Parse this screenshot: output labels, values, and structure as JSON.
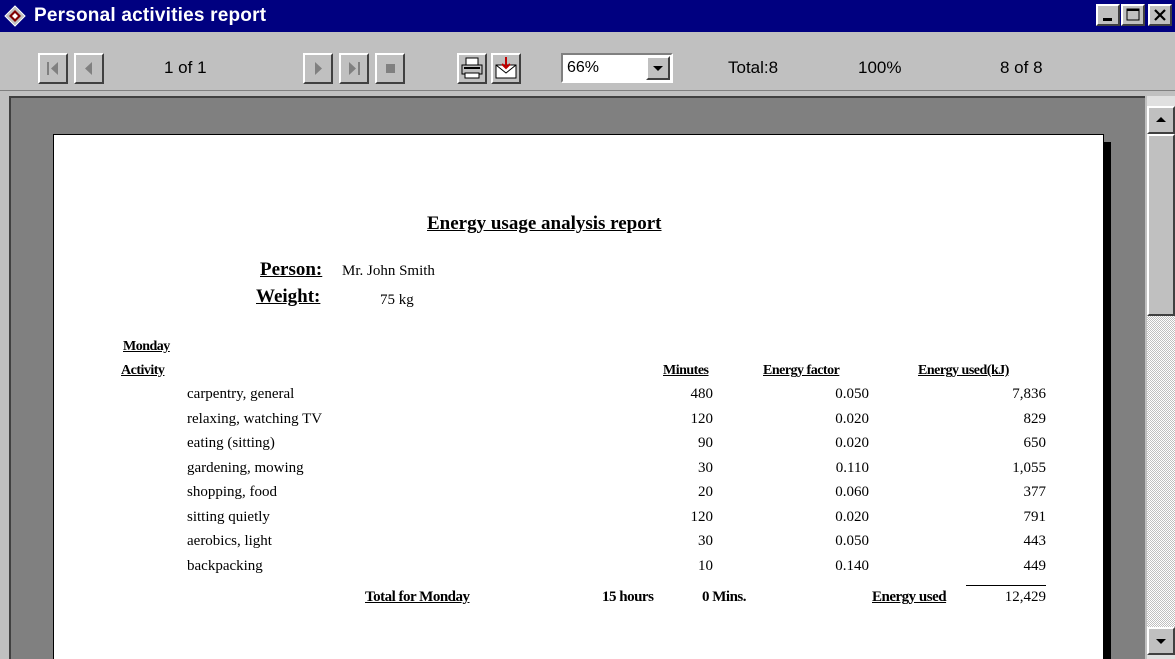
{
  "window": {
    "title": "Personal activities report"
  },
  "toolbar": {
    "page_indicator": "1 of 1",
    "zoom": "66%",
    "total": "Total:8",
    "percent": "100%",
    "records": "8 of 8"
  },
  "report": {
    "title": "Energy usage analysis report",
    "person_label": "Person:",
    "person_value": "Mr. John Smith",
    "weight_label": "Weight:",
    "weight_value": "75 kg",
    "day": "Monday",
    "columns": {
      "activity": "Activity",
      "minutes": "Minutes",
      "factor": "Energy factor",
      "energy": "Energy used(kJ)"
    },
    "rows": [
      {
        "activity": "carpentry, general",
        "minutes": "480",
        "factor": "0.050",
        "energy": "7,836"
      },
      {
        "activity": "relaxing, watching TV",
        "minutes": "120",
        "factor": "0.020",
        "energy": "829"
      },
      {
        "activity": "eating (sitting)",
        "minutes": "90",
        "factor": "0.020",
        "energy": "650"
      },
      {
        "activity": "gardening, mowing",
        "minutes": "30",
        "factor": "0.110",
        "energy": "1,055"
      },
      {
        "activity": "shopping, food",
        "minutes": "20",
        "factor": "0.060",
        "energy": "377"
      },
      {
        "activity": "sitting quietly",
        "minutes": "120",
        "factor": "0.020",
        "energy": "791"
      },
      {
        "activity": "aerobics, light",
        "minutes": "30",
        "factor": "0.050",
        "energy": "443"
      },
      {
        "activity": "backpacking",
        "minutes": "10",
        "factor": "0.140",
        "energy": "449"
      }
    ],
    "total_label": "Total for Monday",
    "total_hours": "15 hours",
    "total_mins": "0 Mins.",
    "energy_used_label": "Energy used",
    "energy_total": "12,429"
  }
}
